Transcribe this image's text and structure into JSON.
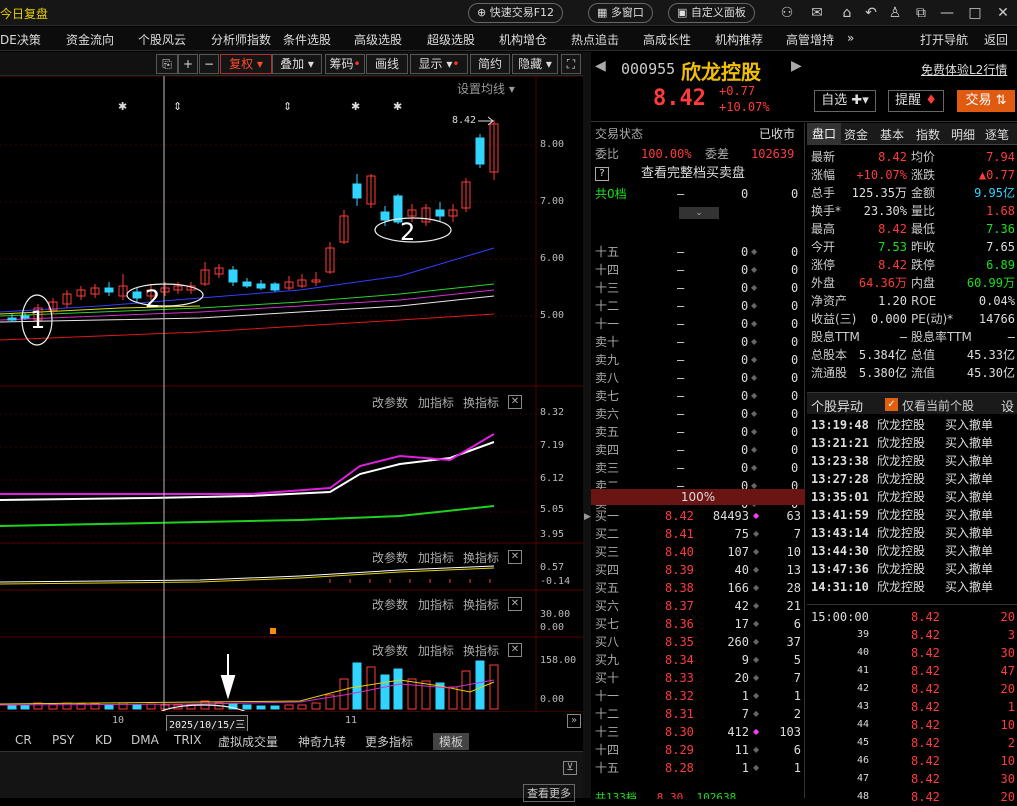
{
  "titlebar": {
    "title": "今日复盘",
    "quick_trade": "快速交易F12",
    "multi_window": "多窗口",
    "custom_panel": "自定义面板"
  },
  "menu": [
    "DE决策",
    "资金流向",
    "个股风云",
    "分析师指数",
    "条件选股",
    "高级选股",
    "超级选股",
    "机构增仓",
    "热点追击",
    "高成长性",
    "机构推荐",
    "高管增持",
    "»",
    "打开导航",
    "返回"
  ],
  "chart_toolbar": {
    "fuquan": "复权",
    "diejia": "叠加",
    "chouma": "筹码",
    "huaxian": "画线",
    "xianshi": "显示",
    "jianyue": "简约",
    "yincang": "隐藏"
  },
  "main_chart": {
    "settings": "设置均线",
    "yticks": [
      "8.00",
      "7.00",
      "6.00",
      "5.00"
    ],
    "price_marker": "8.42",
    "annotations": [
      "1",
      "2",
      "2"
    ]
  },
  "ind1": {
    "yticks": [
      "8.32",
      "7.19",
      "6.12",
      "5.05",
      "3.95"
    ]
  },
  "ind2": {
    "yticks": [
      "0.57",
      "-0.14"
    ]
  },
  "ind3": {
    "yticks": [
      "30.00",
      "0.00"
    ]
  },
  "ind4": {
    "yticks": [
      "158.00",
      "0.00"
    ]
  },
  "panel_tools": {
    "params": "改参数",
    "add": "加指标",
    "swap": "换指标"
  },
  "xaxis": {
    "l1": "10",
    "l2": "11",
    "date": "2025/10/15/三"
  },
  "bottom_tabs": [
    "CR",
    "PSY",
    "KD",
    "DMA",
    "TRIX",
    "虚拟成交量",
    "神奇九转",
    "更多指标",
    "模板"
  ],
  "bottom_more": "查看更多",
  "stock": {
    "code": "000955",
    "name": "欣龙控股",
    "trial": "免费体验L2行情",
    "price": "8.42",
    "change": "+0.77",
    "pct": "+10.07%",
    "watch": "自选",
    "remind": "提醒",
    "trade": "交易"
  },
  "status": {
    "label": "交易状态",
    "value": "已收市",
    "weibi_label": "委比",
    "weibi": "100.00%",
    "weicha_label": "委差",
    "weicha": "102639",
    "full_book": "查看完整档买卖盘",
    "total_levels": "共0档"
  },
  "sells": [
    {
      "l": "十五"
    },
    {
      "l": "十四"
    },
    {
      "l": "十三"
    },
    {
      "l": "十二"
    },
    {
      "l": "十一"
    },
    {
      "l": "卖十"
    },
    {
      "l": "卖九"
    },
    {
      "l": "卖八"
    },
    {
      "l": "卖七"
    },
    {
      "l": "卖六"
    },
    {
      "l": "卖五"
    },
    {
      "l": "卖四"
    },
    {
      "l": "卖三"
    },
    {
      "l": "卖二"
    },
    {
      "l": "卖一"
    }
  ],
  "buy_pct": "100%",
  "buys": [
    {
      "l": "买一",
      "p": "8.42",
      "v": "84493",
      "n": "63"
    },
    {
      "l": "买二",
      "p": "8.41",
      "v": "75",
      "n": "7"
    },
    {
      "l": "买三",
      "p": "8.40",
      "v": "107",
      "n": "10"
    },
    {
      "l": "买四",
      "p": "8.39",
      "v": "40",
      "n": "13"
    },
    {
      "l": "买五",
      "p": "8.38",
      "v": "166",
      "n": "28"
    },
    {
      "l": "买六",
      "p": "8.37",
      "v": "42",
      "n": "21"
    },
    {
      "l": "买七",
      "p": "8.36",
      "v": "17",
      "n": "6"
    },
    {
      "l": "买八",
      "p": "8.35",
      "v": "260",
      "n": "37"
    },
    {
      "l": "买九",
      "p": "8.34",
      "v": "9",
      "n": "5"
    },
    {
      "l": "买十",
      "p": "8.33",
      "v": "20",
      "n": "7"
    },
    {
      "l": "十一",
      "p": "8.32",
      "v": "1",
      "n": "1"
    },
    {
      "l": "十二",
      "p": "8.31",
      "v": "7",
      "n": "2"
    },
    {
      "l": "十三",
      "p": "8.30",
      "v": "412",
      "n": "103"
    },
    {
      "l": "十四",
      "p": "8.29",
      "v": "11",
      "n": "6"
    },
    {
      "l": "十五",
      "p": "8.28",
      "v": "1",
      "n": "1"
    }
  ],
  "right_tabs": [
    "盘口",
    "资金",
    "基本",
    "指数",
    "明细",
    "逐笔"
  ],
  "quote": [
    [
      "最新",
      "8.42",
      "均价",
      "7.94"
    ],
    [
      "涨幅",
      "+10.07%",
      "涨跌",
      "▲0.77"
    ],
    [
      "总手",
      "125.35万",
      "金额",
      "9.95亿"
    ],
    [
      "换手*",
      "23.30%",
      "量比",
      "1.68"
    ],
    [
      "最高",
      "8.42",
      "最低",
      "7.36"
    ],
    [
      "今开",
      "7.53",
      "昨收",
      "7.65"
    ],
    [
      "涨停",
      "8.42",
      "跌停",
      "6.89"
    ],
    [
      "外盘",
      "64.36万",
      "内盘",
      "60.99万"
    ],
    [
      "净资产",
      "1.20",
      "ROE",
      "0.04%"
    ],
    [
      "收益(三)",
      "0.000",
      "PE(动)*",
      "14766"
    ],
    [
      "股息TTM",
      "—",
      "股息率TTM",
      "—"
    ],
    [
      "总股本",
      "5.384亿",
      "总值",
      "45.33亿"
    ],
    [
      "流通股",
      "5.380亿",
      "流值",
      "45.30亿"
    ]
  ],
  "movers": {
    "title": "个股异动",
    "only": "仅看当前个股",
    "settings": "设",
    "rows": [
      [
        "13:19:48",
        "欣龙控股",
        "买入撤单"
      ],
      [
        "13:21:21",
        "欣龙控股",
        "买入撤单"
      ],
      [
        "13:23:38",
        "欣龙控股",
        "买入撤单"
      ],
      [
        "13:27:28",
        "欣龙控股",
        "买入撤单"
      ],
      [
        "13:35:01",
        "欣龙控股",
        "买入撤单"
      ],
      [
        "13:41:59",
        "欣龙控股",
        "买入撤单"
      ],
      [
        "13:43:14",
        "欣龙控股",
        "买入撤单"
      ],
      [
        "13:44:30",
        "欣龙控股",
        "买入撤单"
      ],
      [
        "13:47:36",
        "欣龙控股",
        "买入撤单"
      ],
      [
        "14:31:10",
        "欣龙控股",
        "买入撤单"
      ]
    ]
  },
  "ticks": [
    [
      "15:00:00",
      "8.42",
      "20"
    ],
    [
      "39",
      "8.42",
      "3"
    ],
    [
      "40",
      "8.42",
      "30"
    ],
    [
      "41",
      "8.42",
      "47"
    ],
    [
      "42",
      "8.42",
      "20"
    ],
    [
      "43",
      "8.42",
      "1"
    ],
    [
      "44",
      "8.42",
      "10"
    ],
    [
      "45",
      "8.42",
      "2"
    ],
    [
      "46",
      "8.42",
      "10"
    ],
    [
      "47",
      "8.42",
      "30"
    ],
    [
      "48",
      "8.42",
      "20"
    ]
  ],
  "bottom_partial": {
    "l": "共133档",
    "p": "8.30",
    "v": "102638",
    "n": "48"
  },
  "colors": {
    "up": "#ff3b3b",
    "down": "#18e018",
    "cyan": "#31d4ff"
  }
}
